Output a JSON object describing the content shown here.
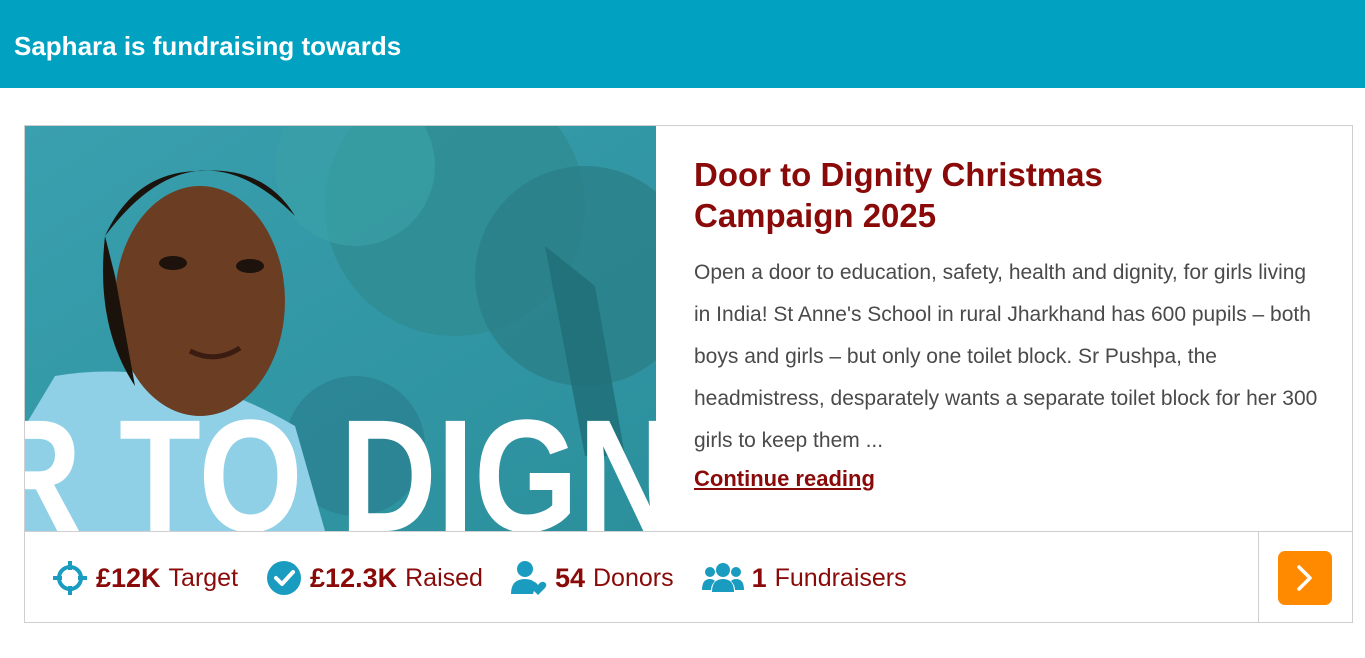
{
  "header": {
    "title": "Saphara is fundraising towards"
  },
  "campaign": {
    "image": {
      "overlay_text": "R TO DIGN"
    },
    "title": "Door to Dignity Christmas Campaign 2025",
    "description": "Open a door to education, safety, health and dignity, for girls living in India! St Anne's School in rural Jharkhand has 600 pupils – both boys and girls – but only one toilet block. Sr Pushpa, the headmistress, desparately wants a separate toilet block for her 300 girls to keep them ...",
    "continue_label": "Continue reading"
  },
  "stats": {
    "target": {
      "value": "£12K",
      "label": "Target",
      "icon": "crosshair-icon"
    },
    "raised": {
      "value": "£12.3K",
      "label": "Raised",
      "icon": "check-circle-icon"
    },
    "donors": {
      "value": "54",
      "label": "Donors",
      "icon": "donor-heart-icon"
    },
    "fundraisers": {
      "value": "1",
      "label": "Fundraisers",
      "icon": "users-group-icon"
    }
  },
  "colors": {
    "header_bg": "#00a1c1",
    "accent_red": "#8a0a0a",
    "icon_teal": "#1a9cc0",
    "arrow_orange": "#ff8a00"
  },
  "arrow_icon": "chevron-right-icon"
}
